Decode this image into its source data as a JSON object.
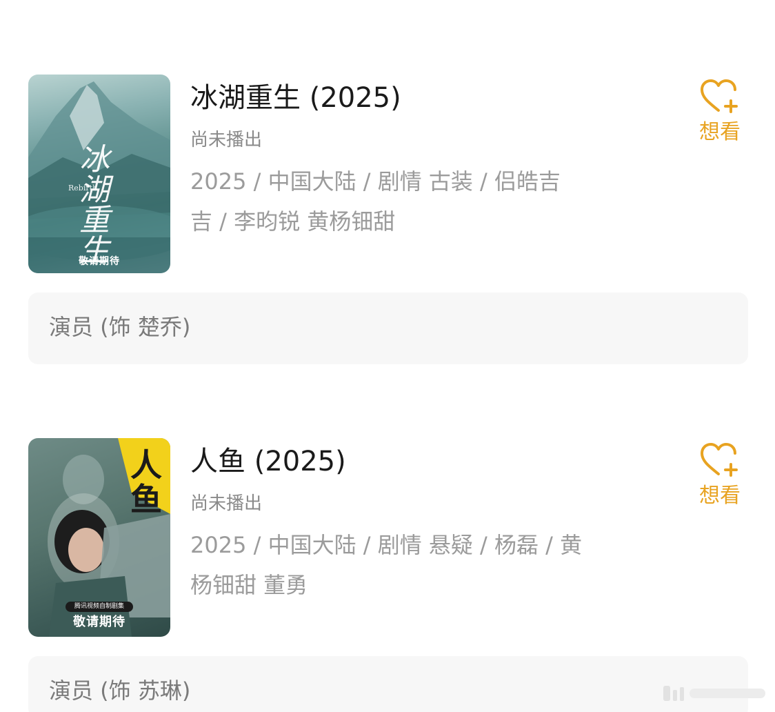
{
  "items": [
    {
      "title": "冰湖重生 (2025)",
      "status": "尚未播出",
      "meta_line1": "2025 / 中国大陆 / 剧情 古装 / 侣皓吉",
      "meta_line2": "吉 / 李昀锐 黄杨钿甜",
      "want_label": "想看",
      "role": "演员 (饰 楚乔)",
      "poster": {
        "caption": "敬请期待",
        "title_art": "冰湖重生",
        "latin": "Rebirth"
      }
    },
    {
      "title": "人鱼 (2025)",
      "status": "尚未播出",
      "meta_line1": "2025 / 中国大陆 / 剧情 悬疑 / 杨磊 / 黄",
      "meta_line2": "杨钿甜 董勇",
      "want_label": "想看",
      "role": "演员 (饰 苏琳)",
      "poster": {
        "caption": "敬请期待",
        "tag": "腾讯视频自制剧集",
        "title_art": "人鱼"
      }
    }
  ],
  "colors": {
    "accent": "#e8a321",
    "text_primary": "#1a1a1a",
    "text_secondary": "#9b9b9b",
    "bar_bg": "#f7f7f7"
  },
  "icons": {
    "want": "heart-plus-icon"
  }
}
